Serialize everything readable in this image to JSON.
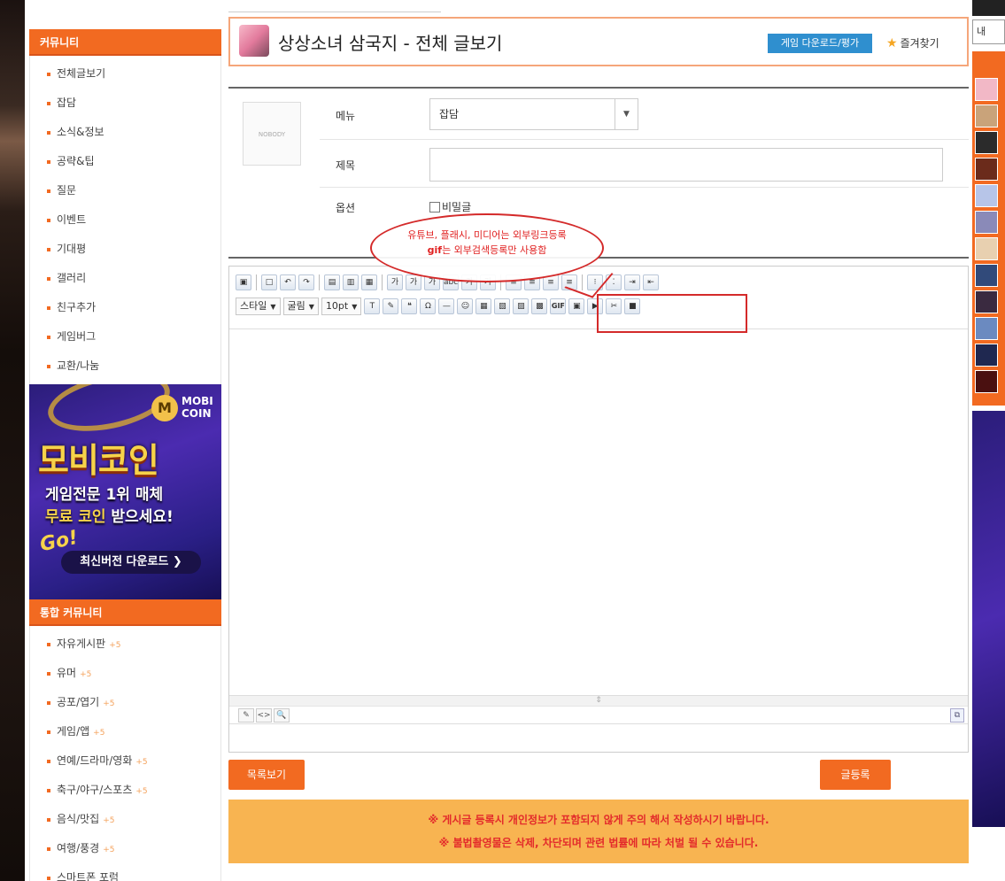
{
  "sidebar": {
    "community_header": "커뮤니티",
    "community_items": [
      {
        "label": "전체글보기"
      },
      {
        "label": "잡담"
      },
      {
        "label": "소식&정보"
      },
      {
        "label": "공략&팁"
      },
      {
        "label": "질문"
      },
      {
        "label": "이벤트"
      },
      {
        "label": "기대평"
      },
      {
        "label": "갤러리"
      },
      {
        "label": "친구추가"
      },
      {
        "label": "게임버그"
      },
      {
        "label": "교환/나눔"
      }
    ],
    "ad": {
      "logo_mark": "M",
      "logo_text": "MOBI COIN",
      "headline": "모비코인",
      "line1": "게임전문 1위 매체",
      "line2_highlight": "무료 코인",
      "line2_rest": " 받으세요!",
      "go_text": "Go!",
      "button": "최신버전 다운로드 ❯"
    },
    "integrated_header": "통합 커뮤니티",
    "integrated_items": [
      {
        "label": "자유게시판",
        "badge": "+5"
      },
      {
        "label": "유머",
        "badge": "+5"
      },
      {
        "label": "공포/엽기",
        "badge": "+5"
      },
      {
        "label": "게임/앱",
        "badge": "+5"
      },
      {
        "label": "연예/드라마/영화",
        "badge": "+5"
      },
      {
        "label": "축구/야구/스포츠",
        "badge": "+5"
      },
      {
        "label": "음식/맛집",
        "badge": "+5"
      },
      {
        "label": "여행/풍경",
        "badge": "+5"
      },
      {
        "label": "스마트폰 포럼",
        "badge": ""
      }
    ]
  },
  "header": {
    "title": "상상소녀 삼국지 - 전체 글보기",
    "download_button": "게임 다운로드/평가",
    "favorite": "즐겨찾기"
  },
  "form": {
    "profile_placeholder": "NOBODY",
    "menu_label": "메뉴",
    "menu_value": "잡담",
    "title_label": "제목",
    "title_value": "",
    "option_label": "옵션",
    "secret_label": "비밀글",
    "callout_line1": "유튜브, 플래시, 미디어는 외부링크등록",
    "callout_line2_bold": "gif",
    "callout_line2_rest": "는 외부검색등록만 사용함"
  },
  "editor": {
    "style_dd": "스타일",
    "font_dd": "굴림",
    "size_dd": "10pt",
    "gif_label": "GIF",
    "toolbar1_icons": [
      "print-icon",
      "new-doc-icon",
      "undo-icon",
      "redo-icon",
      "paste-icon",
      "paste-text-icon",
      "select-all-icon",
      "bold-icon",
      "italic-icon",
      "underline-icon",
      "strike-icon",
      "font-color-icon",
      "bg-color-icon",
      "align-left-icon",
      "align-center-icon",
      "align-right-icon",
      "align-justify-icon",
      "ordered-list-icon",
      "unordered-list-icon",
      "indent-icon",
      "outdent-icon"
    ],
    "toolbar1_glyphs": [
      "▣",
      "□",
      "↶",
      "↷",
      "▤",
      "▥",
      "▦",
      "가",
      "가",
      "가",
      "abc",
      "가",
      "가",
      "≡",
      "≡",
      "≡",
      "≡",
      "⁝",
      "⁚",
      "⇥",
      "⇤"
    ],
    "toolbar2_icons": [
      "format-icon",
      "eraser-icon",
      "quote-icon",
      "special-char-icon",
      "line-icon",
      "emoticon-icon",
      "table-icon",
      "image-icon",
      "photo-icon",
      "media-icon",
      "gif-icon",
      "flash-icon",
      "youtube-icon",
      "page-break-icon",
      "delete-icon"
    ],
    "toolbar2_glyphs": [
      "T",
      "✎",
      "❝",
      "Ω",
      "—",
      "☺",
      "▦",
      "▧",
      "▨",
      "▩",
      "",
      "▣",
      "▶",
      "✂",
      "■"
    ],
    "grip": "⇕",
    "mode_edit": "✎",
    "mode_html": "<>",
    "mode_preview": "🔍",
    "copy_icon": "⧉"
  },
  "buttons": {
    "list": "목록보기",
    "submit": "글등록"
  },
  "notice": {
    "line1": "※ 게시글 등록시 개인정보가 포함되지 않게 주의 해서 작성하시기 바랍니다.",
    "line2": "※ 불법촬영물은 삭제, 차단되며 관련 법률에 따라 처벌 될 수 있습니다."
  },
  "right": {
    "button": "내"
  },
  "colors": {
    "accent": "#f26a21",
    "notice_bg": "#f8b451",
    "notice_text": "#e32b2b",
    "download_btn": "#2f8fcf",
    "callout_red": "#d42a2a"
  }
}
